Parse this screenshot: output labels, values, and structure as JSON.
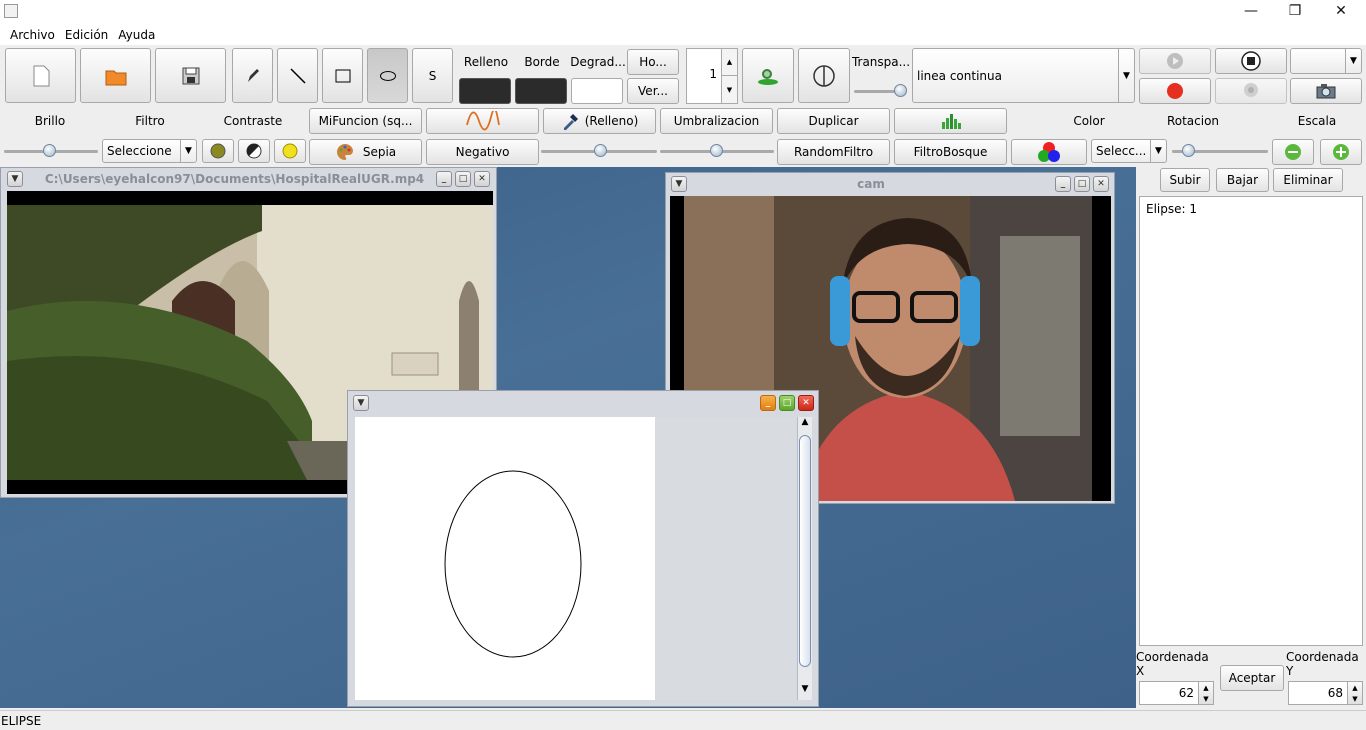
{
  "titlebar": {
    "minimize": "—",
    "restore": "❐",
    "close": "✕"
  },
  "menu": [
    "Archivo",
    "Edición",
    "Ayuda"
  ],
  "toolbar": {
    "relleno_label": "Relleno",
    "borde_label": "Borde",
    "degradado_label": "Degrad...",
    "horizontal_btn": "Ho...",
    "vertical_btn": "Ver...",
    "stroke_width": "1",
    "transparencia_label": "Transpa...",
    "line_style": "linea continua",
    "shape_s_label": "S"
  },
  "row2": {
    "brillo": "Brillo",
    "filtro": "Filtro",
    "contraste": "Contraste",
    "mifuncion": "MiFuncion (sq...",
    "relleno_btn": "(Relleno)",
    "umbralizacion": "Umbralizacion",
    "duplicar": "Duplicar",
    "color": "Color",
    "rotacion": "Rotacion",
    "escala": "Escala"
  },
  "row3": {
    "filtro_combo": "Seleccione",
    "sepia": "Sepia",
    "negativo": "Negativo",
    "randomfiltro": "RandomFiltro",
    "filtrobosque": "FiltroBosque",
    "color_combo": "Selecc..."
  },
  "windows": {
    "video_title": "C:\\Users\\eyehalcon97\\Documents\\HospitalRealUGR.mp4",
    "cam_title": "cam",
    "canvas_title": ""
  },
  "sidepanel": {
    "subir": "Subir",
    "bajar": "Bajar",
    "eliminar": "Eliminar",
    "list_items": [
      "Elipse: 1"
    ],
    "coord_x_label": "Coordenada X",
    "coord_y_label": "Coordenada Y",
    "aceptar": "Aceptar",
    "coord_x_value": "62",
    "coord_y_value": "68"
  },
  "status": "ELIPSE"
}
